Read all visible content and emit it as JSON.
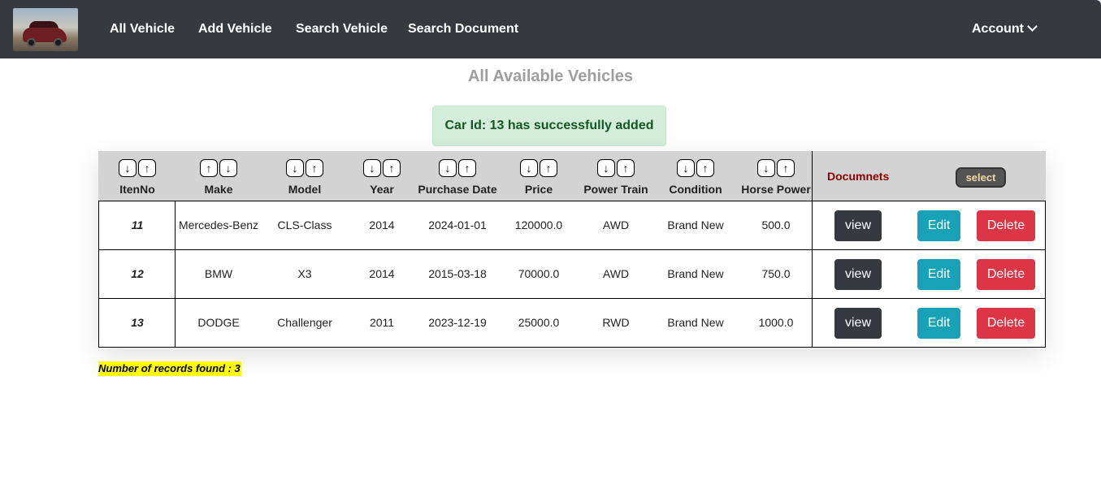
{
  "nav": {
    "links": [
      "All Vehicle",
      "Add Vehicle",
      "Search Vehicle",
      "Search Document"
    ],
    "account_label": "Account"
  },
  "page": {
    "title": "All Available Vehicles",
    "alert": "Car Id: 13 has successfully added"
  },
  "table": {
    "columns": [
      "ItenNo",
      "Make",
      "Model",
      "Year",
      "Purchase Date",
      "Price",
      "Power Train",
      "Condition",
      "Horse Power"
    ],
    "sort_orders": [
      [
        "↓",
        "↑"
      ],
      [
        "↑",
        "↓"
      ],
      [
        "↓",
        "↑"
      ],
      [
        "↓",
        "↑"
      ],
      [
        "↓",
        "↑"
      ],
      [
        "↓",
        "↑"
      ],
      [
        "↓",
        "↑"
      ],
      [
        "↓",
        "↑"
      ],
      [
        "↓",
        "↑"
      ]
    ],
    "documents_label": "Documnets",
    "select_label": "select",
    "rows": [
      [
        "11",
        "Mercedes-Benz",
        "CLS-Class",
        "2014",
        "2024-01-01",
        "120000.0",
        "AWD",
        "Brand New",
        "500.0"
      ],
      [
        "12",
        "BMW",
        "X3",
        "2014",
        "2015-03-18",
        "70000.0",
        "AWD",
        "Brand New",
        "750.0"
      ],
      [
        "13",
        "DODGE",
        "Challenger",
        "2011",
        "2023-12-19",
        "25000.0",
        "RWD",
        "Brand New",
        "1000.0"
      ]
    ],
    "row_buttons": {
      "view": "view",
      "edit": "Edit",
      "delete": "Delete"
    }
  },
  "footer": {
    "records": "Number of records found : 3"
  },
  "colors": {
    "navbar": "#343a40",
    "alert_bg": "#d4edda",
    "alert_text": "#155724",
    "header_bg": "#d3d3d3",
    "documents_label": "#8b0000",
    "view_btn": "#343a40",
    "edit_btn": "#17a2b8",
    "delete_btn": "#dc3545",
    "records_highlight": "#ffff00"
  }
}
